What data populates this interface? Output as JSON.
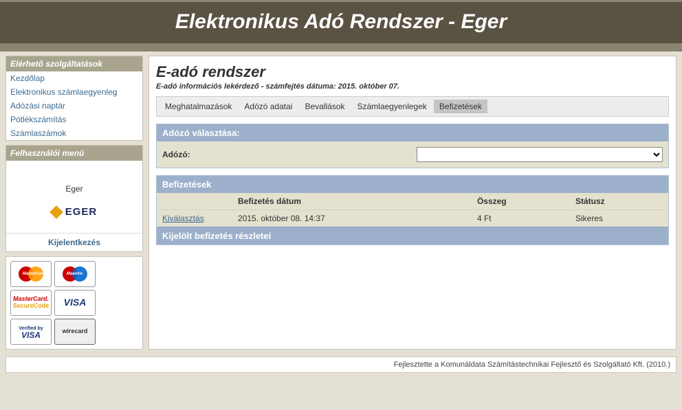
{
  "header": {
    "title": "Elektronikus Adó Rendszer - Eger"
  },
  "sidebar": {
    "services_title": "Elérhető szolgáltatások",
    "items": [
      {
        "label": "Kezdőlap"
      },
      {
        "label": "Elektronikus számlaegyenleg"
      },
      {
        "label": "Adózási naptár"
      },
      {
        "label": "Pótlékszámítás"
      },
      {
        "label": "Számlaszámok"
      }
    ],
    "usermenu_title": "Felhasználói menü",
    "city": "Eger",
    "logo_text": "EGER",
    "logout": "Kijelentkezés"
  },
  "cards": {
    "mastercard": "MasterCard",
    "maestro": "Maestro",
    "securecode_line1": "MasterCard.",
    "securecode_line2": "SecureCode",
    "visa": "VISA",
    "vbv1": "Verified by",
    "vbv2": "VISA",
    "wirecard": "wirecard"
  },
  "main": {
    "title": "E-adó rendszer",
    "subtitle": "E-adó információs lekérdező - számfejtés dátuma: 2015. október 07.",
    "tabs": [
      {
        "label": "Meghatalmazások",
        "active": false
      },
      {
        "label": "Adózó adatai",
        "active": false
      },
      {
        "label": "Bevallások",
        "active": false
      },
      {
        "label": "Számlaegyenlegek",
        "active": false
      },
      {
        "label": "Befizetések",
        "active": true
      }
    ],
    "selector": {
      "panel_title": "Adózó választása:",
      "label": "Adózó:",
      "value": ""
    },
    "payments": {
      "panel_title": "Befizetések",
      "columns": {
        "c0": "",
        "c1": "Befizetés dátum",
        "c2": "Összeg",
        "c3": "Státusz"
      },
      "rows": [
        {
          "select": "Kiválasztás",
          "date": "2015. október 08. 14:37",
          "amount": "4 Ft",
          "status": "Sikeres"
        }
      ],
      "details_title": "Kijelölt befizetés részletei"
    }
  },
  "footer": {
    "text": "Fejlesztette a Komunáldata Számítástechnikai Fejlesztő és Szolgáltató Kft. (2010.)"
  }
}
